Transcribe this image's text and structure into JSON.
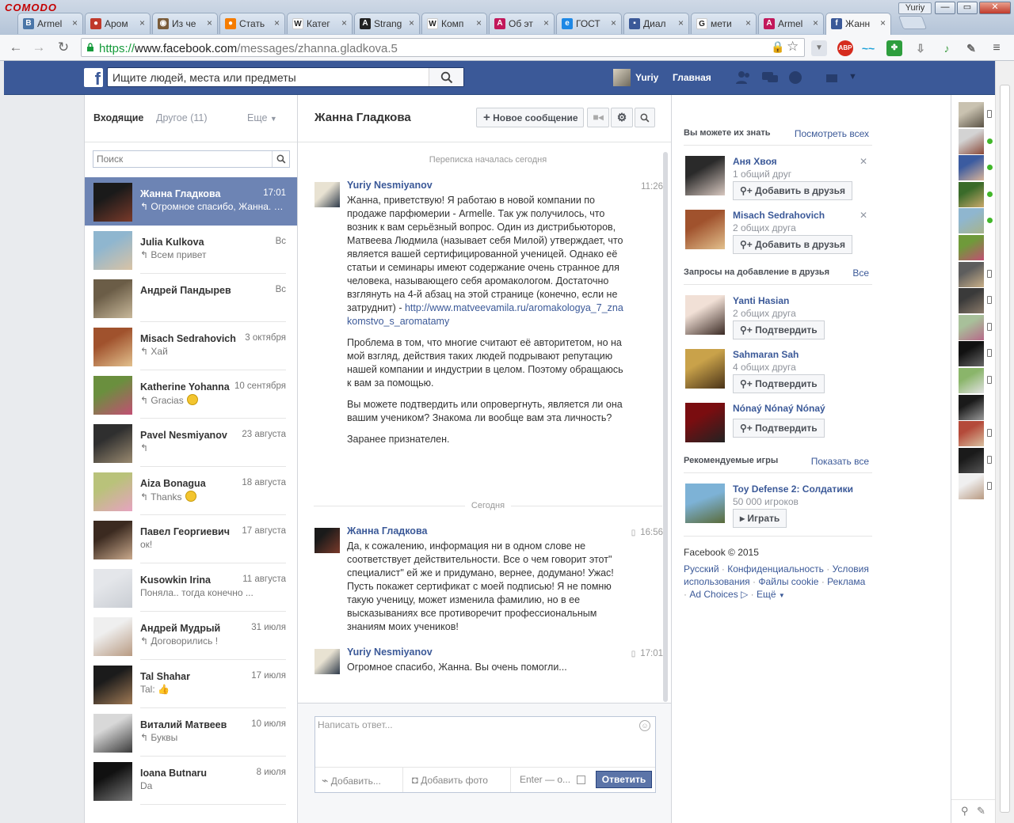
{
  "browser": {
    "brand": "COMODO",
    "user_badge": "Yuriy",
    "tabs": [
      {
        "title": "Armel",
        "icon": "vk-icon",
        "color": "#4a76a8",
        "glyph": "B"
      },
      {
        "title": "Аром",
        "icon": "ladybug-icon",
        "color": "#c0392b",
        "glyph": "●"
      },
      {
        "title": "Из че",
        "icon": "eye-icon",
        "color": "#7a5c3a",
        "glyph": "◉"
      },
      {
        "title": "Стать",
        "icon": "orange-circle-icon",
        "color": "#f57c00",
        "glyph": "●"
      },
      {
        "title": "Катег",
        "icon": "wikipedia-icon",
        "color": "#ffffff",
        "glyph": "W"
      },
      {
        "title": "Strang",
        "icon": "strange-icon",
        "color": "#222222",
        "glyph": "A"
      },
      {
        "title": "Комп",
        "icon": "wikipedia-icon",
        "color": "#ffffff",
        "glyph": "W"
      },
      {
        "title": "Об эт",
        "icon": "armelle-icon",
        "color": "#c2185b",
        "glyph": "A"
      },
      {
        "title": "ГОСТ",
        "icon": "ie-icon",
        "color": "#1e88e5",
        "glyph": "e"
      },
      {
        "title": "Диал",
        "icon": "chat-icon",
        "color": "#3b5998",
        "glyph": "▪"
      },
      {
        "title": "мети",
        "icon": "google-icon",
        "color": "#ffffff",
        "glyph": "G"
      },
      {
        "title": "Armel",
        "icon": "armelle-icon",
        "color": "#c2185b",
        "glyph": "A"
      },
      {
        "title": "Жанн",
        "icon": "facebook-icon",
        "color": "#3b5998",
        "glyph": "f"
      }
    ],
    "url": {
      "scheme": "https://",
      "host": "www.facebook.com",
      "path": "/messages/zhanna.gladkova.5"
    }
  },
  "fb": {
    "search_placeholder": "Ищите людей, места или предметы",
    "user_name": "Yuriy",
    "home_label": "Главная"
  },
  "inbox": {
    "tab_inbox": "Входящие",
    "tab_other": "Другое (11)",
    "tab_more": "Еще",
    "search_placeholder": "Поиск",
    "conversations": [
      {
        "name": "Жанна Гладкова",
        "time": "17:01",
        "preview": "↰ Огромное спасибо, Жанна. Вы очень помогли...",
        "selected": true,
        "avatar": [
          "#1a1a1a",
          "#7a3a2a"
        ]
      },
      {
        "name": "Julia Kulkova",
        "time": "Вс",
        "preview": "↰ Всем привет",
        "avatar": [
          "#8fb6cf",
          "#d9c3a5"
        ]
      },
      {
        "name": "Андрей Пандырев",
        "time": "Вс",
        "preview": "",
        "avatar": [
          "#6b5d47",
          "#c8b89a"
        ]
      },
      {
        "name": "Misach Sedrahovich",
        "time": "3 октября",
        "preview": "↰ Хай",
        "avatar": [
          "#a0522d",
          "#e2c08d"
        ]
      },
      {
        "name": "Katherine Yohanna",
        "time": "10 сентября",
        "preview": "↰ Gracias",
        "emoji": true,
        "avatar": [
          "#6a8f3e",
          "#c24f73"
        ]
      },
      {
        "name": "Pavel Nesmiyanov",
        "time": "23 августа",
        "preview": "↰",
        "avatar": [
          "#2f2f2f",
          "#9a8a70"
        ]
      },
      {
        "name": "Aiza Bonagua",
        "time": "18 августа",
        "preview": "↰ Thanks",
        "emoji": true,
        "avatar": [
          "#b9c27a",
          "#e6a3c0"
        ]
      },
      {
        "name": "Павел Георгиевич",
        "time": "17 августа",
        "preview": "ок!",
        "avatar": [
          "#3b2a20",
          "#c9a98c"
        ]
      },
      {
        "name": "Kusowkin Irina",
        "time": "11 августа",
        "preview": "Поняла.. тогда конечно ...",
        "avatar": [
          "#e4e6ea",
          "#c9cdd3"
        ]
      },
      {
        "name": "Андрей Мудрый",
        "time": "31 июля",
        "preview": "↰ Договорились !",
        "avatar": [
          "#efefef",
          "#b89a82"
        ]
      },
      {
        "name": "Tal Shahar",
        "time": "17 июля",
        "preview": "Tal:",
        "thumb": true,
        "avatar": [
          "#1b1b1b",
          "#a07a55"
        ]
      },
      {
        "name": "Виталий Матвеев",
        "time": "10 июля",
        "preview": "↰ Буквы",
        "avatar": [
          "#d8d8d8",
          "#3a3a3a"
        ]
      },
      {
        "name": "Ioana Butnaru",
        "time": "8 июля",
        "preview": "Da",
        "avatar": [
          "#111111",
          "#777777"
        ]
      }
    ]
  },
  "thread": {
    "title": "Жанна Гладкова",
    "new_message_label": "Новое сообщение",
    "started_label": "Переписка началась сегодня",
    "today_label": "Сегодня",
    "messages": [
      {
        "author": "Yuriy Nesmiyanov",
        "time": "11:26",
        "paragraphs": [
          "Жанна, приветствую! Я работаю в новой компании по продаже парфюмерии - Armelle. Так уж получилось, что возник к вам серьёзный вопрос. Один из дистрибьюторов, Матвеева Людмила (называет себя Милой) утверждает, что является вашей сертифицированной ученицей. Однако её статьи и семинары имеют содержание очень странное для человека, называющего себя аромакологом. Достаточно взглянуть на 4-й абзац на этой странице (конечно, если не затруднит) -",
          "Проблема в том, что многие считают её авторитетом, но на мой взгляд, действия таких людей подрывают репутацию нашей компании и индустрии в целом. Поэтому обращаюсь к вам за помощью.",
          "Вы можете подтвердить или опровергнуть, является ли она вашим учеником? Знакома ли вообще вам эта личность?",
          "Заранее признателен."
        ],
        "link": "http://www.matveevamila.ru/aromakologya_7_znakomstvo_s_aromatamy"
      },
      {
        "author": "Жанна Гладкова",
        "time": "16:56",
        "paragraphs": [
          "Да, к сожалению, информация ни в одном слове не соответствует действительности. Все о чем говорит этот\" специалист\" ей же и придумано, вернее, додумано! Ужас! Пусть покажет сертификат с моей подписью! Я не помню такую ученицу, может изменила фамилию, но в ее высказываниях все противоречит профессиональным знаниям моих учеников!"
        ]
      },
      {
        "author": "Yuriy Nesmiyanov",
        "time": "17:01",
        "paragraphs": [
          "Огромное спасибо, Жанна. Вы очень помогли..."
        ]
      }
    ]
  },
  "composer": {
    "placeholder": "Написать ответ...",
    "attach_label": "Добавить...",
    "photo_label": "Добавить фото",
    "enter_label": "Enter — о...",
    "send_label": "Ответить"
  },
  "sidebar": {
    "pymk_title": "Вы можете их знать",
    "pymk_link": "Посмотреть всех",
    "pymk": [
      {
        "name": "Аня Хвоя",
        "detail": "1 общий друг",
        "button": "Добавить в друзья",
        "avatar": [
          "#2a2a2a",
          "#d8c8c0"
        ]
      },
      {
        "name": "Misach Sedrahovich",
        "detail": "2 общих друга",
        "button": "Добавить в друзья",
        "avatar": [
          "#a0522d",
          "#e2c08d"
        ]
      }
    ],
    "requests_title": "Запросы на добавление в друзья",
    "requests_link": "Все",
    "requests": [
      {
        "name": "Yanti Hasian",
        "detail": "2 общих друга",
        "button": "Подтвердить",
        "avatar": [
          "#f1e0d6",
          "#3a2a24"
        ]
      },
      {
        "name": "Sahmaran Sah",
        "detail": "4 общих друга",
        "button": "Подтвердить",
        "avatar": [
          "#c9a24a",
          "#4a3318"
        ]
      },
      {
        "name": "Nónaý Nónaý Nónaý",
        "detail": "",
        "button": "Подтвердить",
        "avatar": [
          "#7a0d10",
          "#222222"
        ]
      }
    ],
    "games_title": "Рекомендуемые игры",
    "games_link": "Показать все",
    "game": {
      "name": "Toy Defense 2: Солдатики",
      "detail": "50 000 игроков",
      "button": "Играть",
      "avatar": [
        "#7db2d6",
        "#5a6b3a"
      ]
    },
    "copyright": "Facebook © 2015",
    "footer_links": [
      "Русский",
      "Конфиденциальность",
      "Условия использования",
      "Файлы cookie",
      "Реклама",
      "Ad Choices",
      "Ещё"
    ]
  },
  "chat_sidebar": {
    "contacts": [
      {
        "status": "mobile",
        "avatar": [
          "#c9c2b0",
          "#5b5346"
        ]
      },
      {
        "status": "online",
        "avatar": [
          "#d3d3d3",
          "#8a4a3a"
        ]
      },
      {
        "status": "online",
        "avatar": [
          "#3b5ba0",
          "#d9b49a"
        ]
      },
      {
        "status": "online",
        "avatar": [
          "#3a6b2a",
          "#c9a86a"
        ]
      },
      {
        "status": "online",
        "avatar": [
          "#8fb6cf",
          "#a7b48a"
        ]
      },
      {
        "status": "none",
        "avatar": [
          "#6f9a3a",
          "#c24f73"
        ]
      },
      {
        "status": "mobile",
        "avatar": [
          "#5d5d5d",
          "#c9b089"
        ]
      },
      {
        "status": "mobile",
        "avatar": [
          "#3a3a3a",
          "#8a7a6a"
        ]
      },
      {
        "status": "mobile",
        "avatar": [
          "#a8c09a",
          "#b76a8a"
        ]
      },
      {
        "status": "mobile",
        "avatar": [
          "#111111",
          "#666666"
        ]
      },
      {
        "status": "mobile",
        "avatar": [
          "#8ab56a",
          "#e2e2e2"
        ]
      },
      {
        "status": "none",
        "avatar": [
          "#1a1a1a",
          "#9a9a9a"
        ]
      },
      {
        "status": "mobile",
        "avatar": [
          "#b44a3a",
          "#d9c0a0"
        ]
      },
      {
        "status": "mobile",
        "avatar": [
          "#1a1a1a",
          "#555555"
        ]
      },
      {
        "status": "mobile",
        "avatar": [
          "#efefef",
          "#b89a82"
        ]
      }
    ]
  }
}
